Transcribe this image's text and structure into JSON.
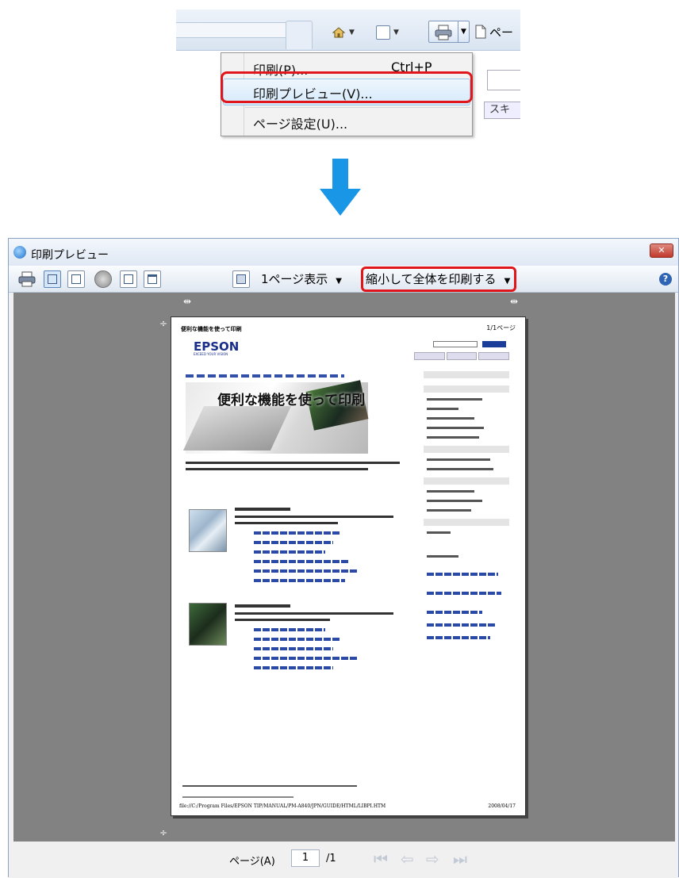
{
  "ie_menu": {
    "print_label": "印刷(P)...",
    "print_shortcut": "Ctrl+P",
    "preview_label": "印刷プレビュー(V)...",
    "page_setup_label": "ページ設定(U)...",
    "page_button_partial": "ペー",
    "scan_partial": "スキ"
  },
  "window": {
    "title": "印刷プレビュー",
    "close_glyph": "✕",
    "help_glyph": "?"
  },
  "toolbar": {
    "pages_view": "1ページ表示",
    "shrink_option": "縮小して全体を印刷する",
    "dropdown_glyph": "▼"
  },
  "document_page": {
    "title": "便利な機能を使って印刷",
    "page_number": "1/1ページ",
    "brand": "EPSON",
    "brand_sub": "EXCEED YOUR VISION",
    "hero_title": "便利な機能を使って印刷",
    "footer_url": "file://C:/Program Files/EPSON TIP/MANUAL/PM-A840/JPN/GUIDE/HTML/LIBPI.HTM",
    "footer_date": "2008/04/17"
  },
  "statusbar": {
    "page_label": "ページ(A)",
    "page_value": "1",
    "page_total": "/1",
    "first_glyph": "⏮",
    "prev_glyph": "⇦",
    "next_glyph": "⇨",
    "last_glyph": "⏭"
  },
  "colors": {
    "highlight_red": "#e0161b",
    "arrow_blue": "#1a96e6"
  }
}
